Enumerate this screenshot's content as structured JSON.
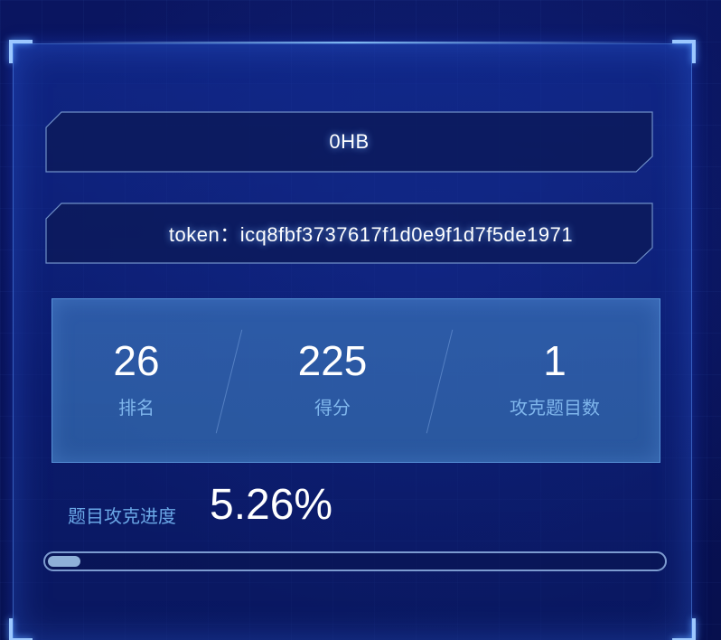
{
  "team": {
    "name": "0HB"
  },
  "token": {
    "label": "token：icq8fbf3737617f1d0e9f1d7f5de1971"
  },
  "stats": {
    "rank": {
      "value": "26",
      "label": "排名"
    },
    "score": {
      "value": "225",
      "label": "得分"
    },
    "solved": {
      "value": "1",
      "label": "攻克题目数"
    }
  },
  "progress": {
    "label": "题目攻克进度",
    "value_text": "5.26%",
    "fraction": 0.0526
  },
  "colors": {
    "accent": "#7fb6ec",
    "panel_border": "#5a96ff"
  }
}
